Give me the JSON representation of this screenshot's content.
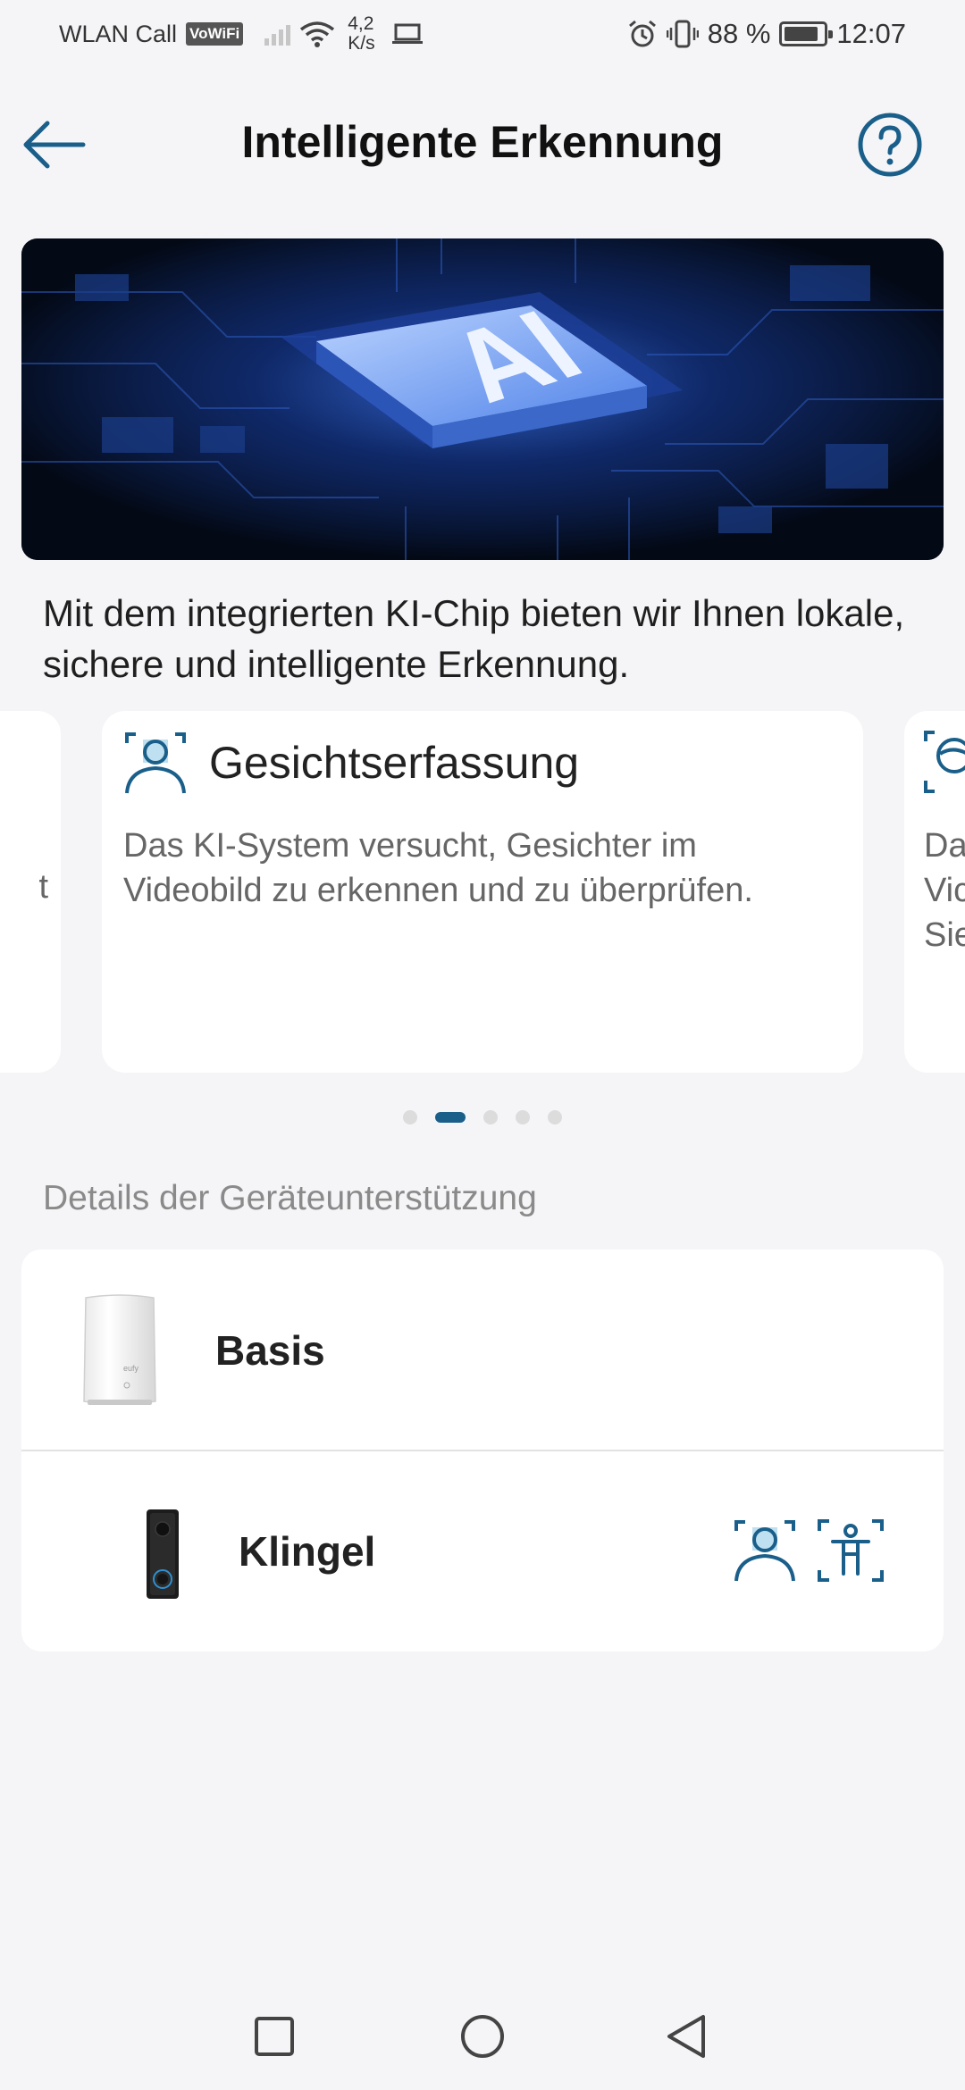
{
  "status_bar": {
    "carrier": "WLAN Call",
    "vowifi": "VoWiFi",
    "speed_value": "4,2",
    "speed_unit": "K/s",
    "battery": "88 %",
    "time": "12:07",
    "battery_level": 0.88
  },
  "header": {
    "title": "Intelligente Erkennung",
    "back_icon": "arrow-left-icon",
    "help_icon": "question-circle-icon"
  },
  "banner": {
    "chip_text": "AI"
  },
  "intro": {
    "text": "Mit dem integrierten KI-Chip bieten wir Ihnen lokale, sichere und intelligente Erkennung."
  },
  "carousel": {
    "prev_fragment": "t",
    "main": {
      "icon": "face-detection-icon",
      "title": "Gesichtserfassung",
      "description": "Das KI-System versucht, Gesichter im Videobild zu erkennen und zu überprüfen."
    },
    "next_fragment_lines": [
      "Da",
      "Vic",
      "Sie"
    ],
    "dot_count": 5,
    "active_index": 1
  },
  "section": {
    "label": "Details der Geräteunterstützung"
  },
  "devices": [
    {
      "name": "Basis",
      "image": "homebase-image"
    },
    {
      "name": "Klingel",
      "image": "doorbell-image",
      "features": [
        "face-detection-icon",
        "human-detection-icon"
      ]
    }
  ],
  "colors": {
    "accent": "#1a5f8a",
    "background": "#f5f5f7",
    "card": "#ffffff"
  }
}
